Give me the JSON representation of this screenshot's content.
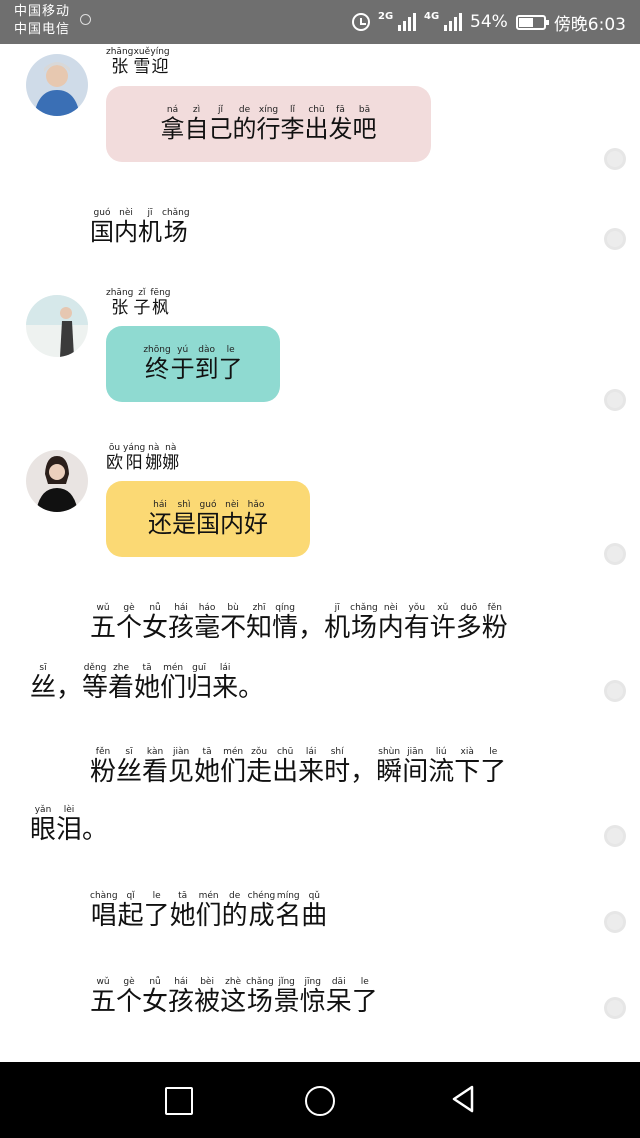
{
  "status_bar": {
    "carrier1": "中国移动",
    "carrier2": "中国电信",
    "net1": "2G",
    "net2": "4G",
    "battery": "54%",
    "time": "傍晚6:03"
  },
  "messages": [
    {
      "name": "张雪迎",
      "name_pinyin": [
        "zhāng",
        "xuě",
        "yíng"
      ],
      "text": "拿自己的行李出发吧",
      "text_pinyin": [
        "ná",
        "zì",
        "jǐ",
        "de",
        "xíng",
        "lǐ",
        "chū",
        "fā",
        "bā"
      ]
    },
    {
      "text": "国内机场",
      "text_pinyin": [
        "guó",
        "nèi",
        "jī",
        "chǎng"
      ]
    },
    {
      "name": "张子枫",
      "name_pinyin": [
        "zhāng",
        "zǐ",
        "fēng"
      ],
      "text": "终于到了",
      "text_pinyin": [
        "zhōng",
        "yú",
        "dào",
        "le"
      ]
    },
    {
      "name": "欧阳娜娜",
      "name_pinyin": [
        "ōu",
        "yáng",
        "nà",
        "nà"
      ],
      "text": "还是国内好",
      "text_pinyin": [
        "hái",
        "shì",
        "guó",
        "nèi",
        "hǎo"
      ]
    }
  ],
  "narration": [
    {
      "line1": "五个女孩毫不知情，机场内有许多粉",
      "p1": [
        "wǔ",
        "gè",
        "nǚ",
        "hái",
        "háo",
        "bù",
        "zhī",
        "qíng",
        "",
        "jī",
        "chǎng",
        "nèi",
        "yǒu",
        "xǔ",
        "duō",
        "fěn"
      ],
      "line2": "丝，等着她们归来。",
      "p2": [
        "sī",
        "",
        "děng",
        "zhe",
        "tā",
        "mén",
        "guī",
        "lái",
        ""
      ]
    },
    {
      "line1": "粉丝看见她们走出来时，瞬间流下了",
      "p1": [
        "fěn",
        "sī",
        "kàn",
        "jiàn",
        "tā",
        "mén",
        "zǒu",
        "chū",
        "lái",
        "shí",
        "",
        "shùn",
        "jiān",
        "liú",
        "xià",
        "le"
      ],
      "line2": "眼泪。",
      "p2": [
        "yǎn",
        "lèi",
        ""
      ]
    },
    {
      "line1": "唱起了她们的成名曲",
      "p1": [
        "chàng",
        "qǐ",
        "le",
        "tā",
        "mén",
        "de",
        "chéng",
        "míng",
        "qǔ"
      ]
    },
    {
      "line1": "五个女孩被这场景惊呆了",
      "p1": [
        "wǔ",
        "gè",
        "nǚ",
        "hái",
        "bèi",
        "zhè",
        "chǎng",
        "jǐng",
        "jīng",
        "dāi",
        "le"
      ]
    }
  ]
}
